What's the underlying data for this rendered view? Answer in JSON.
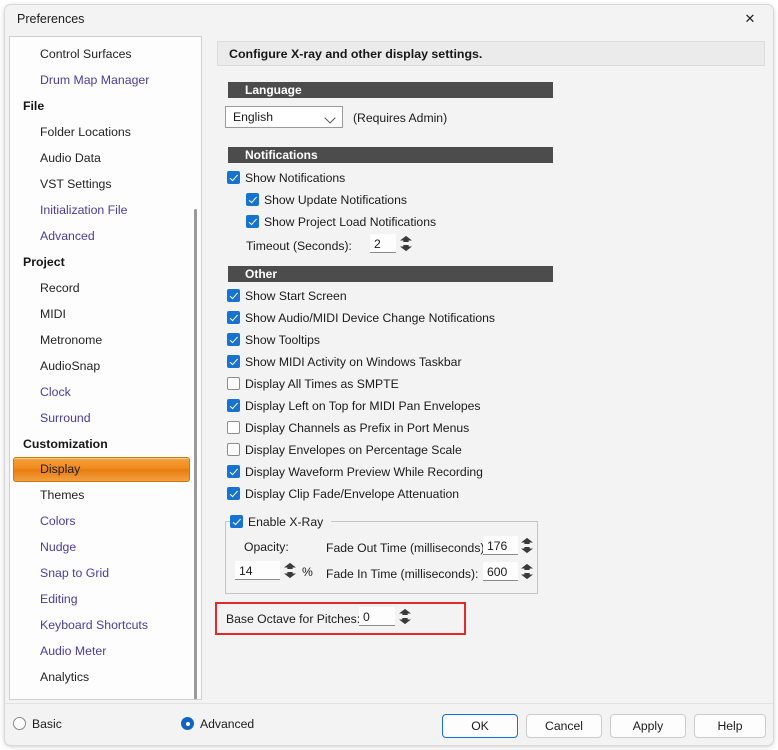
{
  "window": {
    "title": "Preferences",
    "close_icon": "close-icon"
  },
  "sidebar": {
    "items": [
      {
        "label": "Control Surfaces",
        "type": "leaf",
        "style": "plain"
      },
      {
        "label": "Drum Map Manager",
        "type": "leaf",
        "style": "link"
      },
      {
        "label": "File",
        "type": "group"
      },
      {
        "label": "Folder Locations",
        "type": "leaf",
        "style": "plain"
      },
      {
        "label": "Audio Data",
        "type": "leaf",
        "style": "plain"
      },
      {
        "label": "VST Settings",
        "type": "leaf",
        "style": "plain"
      },
      {
        "label": "Initialization File",
        "type": "leaf",
        "style": "link"
      },
      {
        "label": "Advanced",
        "type": "leaf",
        "style": "link"
      },
      {
        "label": "Project",
        "type": "group"
      },
      {
        "label": "Record",
        "type": "leaf",
        "style": "plain"
      },
      {
        "label": "MIDI",
        "type": "leaf",
        "style": "plain"
      },
      {
        "label": "Metronome",
        "type": "leaf",
        "style": "plain"
      },
      {
        "label": "AudioSnap",
        "type": "leaf",
        "style": "plain"
      },
      {
        "label": "Clock",
        "type": "leaf",
        "style": "link"
      },
      {
        "label": "Surround",
        "type": "leaf",
        "style": "link"
      },
      {
        "label": "Customization",
        "type": "group"
      },
      {
        "label": "Display",
        "type": "leaf",
        "style": "selected"
      },
      {
        "label": "Themes",
        "type": "leaf",
        "style": "plain"
      },
      {
        "label": "Colors",
        "type": "leaf",
        "style": "link"
      },
      {
        "label": "Nudge",
        "type": "leaf",
        "style": "link"
      },
      {
        "label": "Snap to Grid",
        "type": "leaf",
        "style": "link"
      },
      {
        "label": "Editing",
        "type": "leaf",
        "style": "link"
      },
      {
        "label": "Keyboard Shortcuts",
        "type": "leaf",
        "style": "link"
      },
      {
        "label": "Audio Meter",
        "type": "leaf",
        "style": "link"
      },
      {
        "label": "Analytics",
        "type": "leaf",
        "style": "plain"
      }
    ],
    "selected": "Display"
  },
  "main": {
    "header": "Configure X-ray and other display settings.",
    "language": {
      "section_title": "Language",
      "selected": "English",
      "note": "(Requires Admin)"
    },
    "notifications": {
      "section_title": "Notifications",
      "show_notifications": {
        "label": "Show Notifications",
        "checked": true
      },
      "show_update": {
        "label": "Show Update Notifications",
        "checked": true
      },
      "show_project_load": {
        "label": "Show Project Load Notifications",
        "checked": true
      },
      "timeout_label": "Timeout (Seconds):",
      "timeout_value": "2"
    },
    "other": {
      "section_title": "Other",
      "checkboxes": [
        {
          "label": "Show Start Screen",
          "checked": true
        },
        {
          "label": "Show Audio/MIDI Device Change Notifications",
          "checked": true
        },
        {
          "label": "Show Tooltips",
          "checked": true
        },
        {
          "label": "Show MIDI Activity on Windows Taskbar",
          "checked": true
        },
        {
          "label": "Display All Times as SMPTE",
          "checked": false
        },
        {
          "label": "Display Left on Top for MIDI Pan Envelopes",
          "checked": true
        },
        {
          "label": "Display Channels as Prefix in Port Menus",
          "checked": false
        },
        {
          "label": "Display Envelopes on Percentage Scale",
          "checked": false
        },
        {
          "label": "Display Waveform Preview While Recording",
          "checked": true
        },
        {
          "label": "Display Clip Fade/Envelope Attenuation",
          "checked": true
        }
      ]
    },
    "xray": {
      "enable_label": "Enable X-Ray",
      "enabled": true,
      "opacity_label": "Opacity:",
      "opacity_value": "14",
      "opacity_unit": "%",
      "fade_out_label": "Fade Out Time (milliseconds):",
      "fade_out_value": "176",
      "fade_in_label": "Fade In Time (milliseconds):",
      "fade_in_value": "600"
    },
    "base_octave": {
      "label": "Base Octave for Pitches:",
      "value": "0",
      "highlight_color": "#e02a2a"
    }
  },
  "footer": {
    "basic_radio": "Basic",
    "advanced_radio": "Advanced",
    "selected_mode": "Advanced",
    "ok": "OK",
    "cancel": "Cancel",
    "apply": "Apply",
    "help": "Help"
  }
}
